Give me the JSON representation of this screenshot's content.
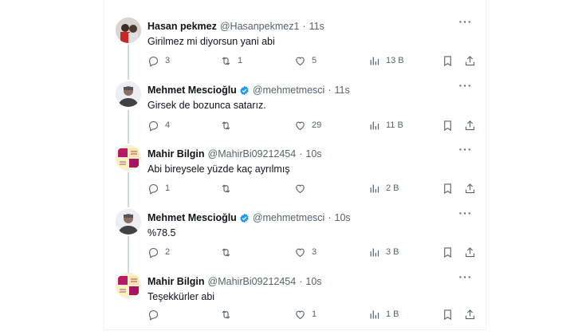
{
  "tweets": [
    {
      "name": "Hasan pekmez",
      "handle": "@Hasanpekmez1",
      "sep": "·",
      "time": "11s",
      "verified": false,
      "text": "Girilmez mi diyorsun yani abi",
      "replies": "3",
      "reposts": "1",
      "likes": "5",
      "views": "13 B"
    },
    {
      "name": "Mehmet Mescioğlu",
      "handle": "@mehmetmesci",
      "sep": "·",
      "time": "11s",
      "verified": true,
      "text": "Girsek de bozunca satarız.",
      "replies": "4",
      "reposts": "",
      "likes": "29",
      "views": "11 B"
    },
    {
      "name": "Mahir Bilgin",
      "handle": "@MahirBi09212454",
      "sep": "·",
      "time": "10s",
      "verified": false,
      "text": "Abi bireysele yüzde kaç ayrılmış",
      "replies": "1",
      "reposts": "",
      "likes": "",
      "views": "2 B"
    },
    {
      "name": "Mehmet Mescioğlu",
      "handle": "@mehmetmesci",
      "sep": "·",
      "time": "10s",
      "verified": true,
      "text": "%78.5",
      "replies": "2",
      "reposts": "",
      "likes": "3",
      "views": "3 B"
    },
    {
      "name": "Mahir Bilgin",
      "handle": "@MahirBi09212454",
      "sep": "·",
      "time": "10s",
      "verified": false,
      "text": "Teşekkürler abi",
      "replies": "",
      "reposts": "",
      "likes": "1",
      "views": "1 B"
    }
  ],
  "colors": {
    "verified": "#1d9bf0",
    "muted": "#536471",
    "thread_line": "#cfd9de"
  },
  "icons": [
    "reply-icon",
    "repost-icon",
    "like-icon",
    "views-icon",
    "bookmark-icon",
    "share-icon",
    "more-icon",
    "verified-badge-icon"
  ]
}
